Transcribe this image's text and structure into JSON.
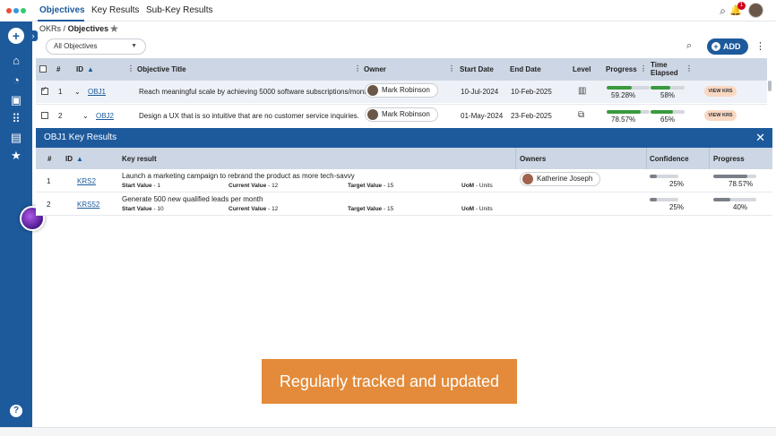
{
  "nav": {
    "tabs": [
      "Objectives",
      "Key Results",
      "Sub-Key Results"
    ],
    "notification_count": "1"
  },
  "breadcrumb": {
    "parent": "OKRs",
    "sep": "/",
    "current": "Objectives"
  },
  "toolbar": {
    "filter_value": "All Objectives",
    "add_label": "ADD"
  },
  "objectives": {
    "headers": {
      "num": "#",
      "id": "ID",
      "title": "Objective Title",
      "owner": "Owner",
      "start": "Start Date",
      "end": "End Date",
      "level": "Level",
      "progress": "Progress",
      "elapsed_1": "Time",
      "elapsed_2": "Elapsed"
    },
    "rows": [
      {
        "num": "1",
        "id": "OBJ1",
        "title": "Reach meaningful scale by achieving 5000 software subscriptions/month",
        "owner": "Mark Robinson",
        "start": "10-Jul-2024",
        "end": "10-Feb-2025",
        "progress": "59.28%",
        "progress_value": 59.28,
        "elapsed": "58%",
        "elapsed_value": 58,
        "action": "VIEW KRS"
      },
      {
        "num": "2",
        "id": "OBJ2",
        "title": "Design a UX that is so intuitive that are no customer service inquiries.",
        "owner": "Mark Robinson",
        "start": "01-May-2024",
        "end": "23-Feb-2025",
        "progress": "78.57%",
        "progress_value": 78.57,
        "elapsed": "65%",
        "elapsed_value": 65,
        "action": "VIEW KRS"
      }
    ]
  },
  "kr_panel": {
    "title": "OBJ1 Key Results",
    "headers": {
      "num": "#",
      "id": "ID",
      "key_result": "Key result",
      "owners": "Owners",
      "confidence": "Confidence",
      "progress": "Progress"
    },
    "labels": {
      "start": "Start Value",
      "current": "Current Value",
      "target": "Target Value",
      "uom": "UoM",
      "dash": "-"
    },
    "rows": [
      {
        "num": "1",
        "id": "KRS2",
        "title": "Launch a marketing campaign to rebrand the product as more tech-savvy",
        "start": "1",
        "current": "12",
        "target": "15",
        "uom": "Units",
        "owner": "Katherine Joseph",
        "confidence": "25%",
        "confidence_value": 25,
        "progress": "78.57%",
        "progress_value": 78.57
      },
      {
        "num": "2",
        "id": "KRS52",
        "title": "Generate 500 new qualified leads per month",
        "start": "10",
        "current": "12",
        "target": "15",
        "uom": "Units",
        "owner": "",
        "confidence": "25%",
        "confidence_value": 25,
        "progress": "40%",
        "progress_value": 40
      }
    ]
  },
  "caption": "Regularly tracked and updated",
  "colors": {
    "primary": "#1d5a9c",
    "header_bg": "#cdd6e4",
    "progress_green": "#3a9a3e",
    "bar_gray": "#7a7f87",
    "caption_orange": "#e38b3a",
    "viewkrs_bg": "#f9d8c3"
  }
}
